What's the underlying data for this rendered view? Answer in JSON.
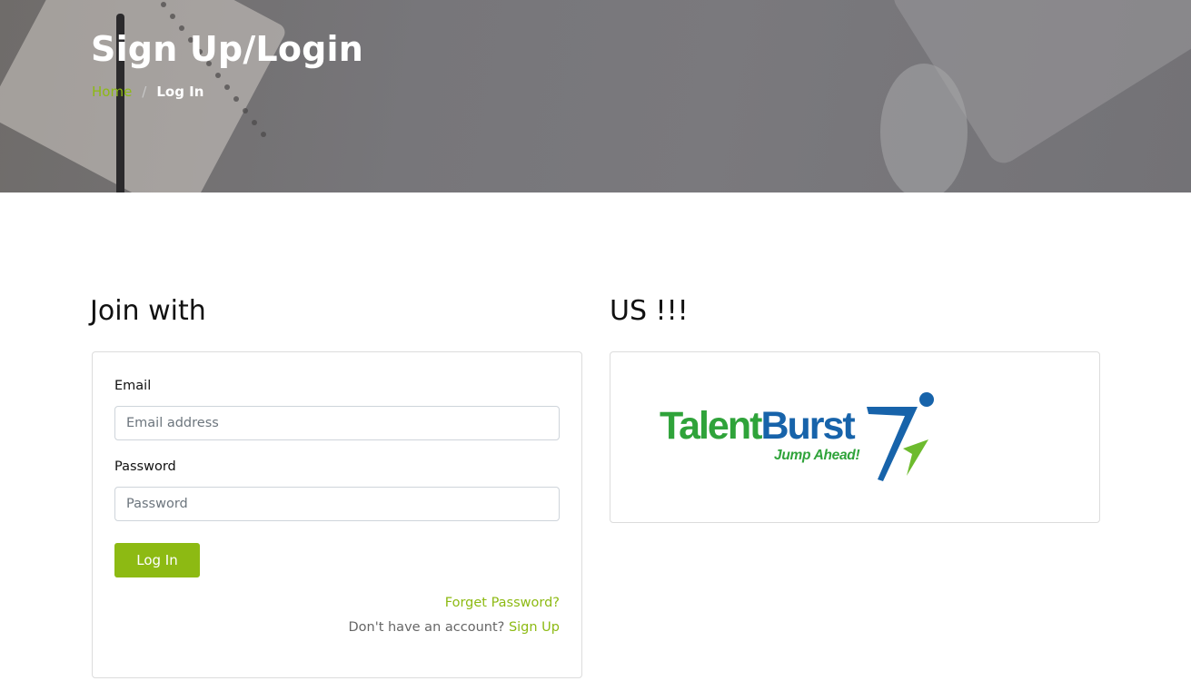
{
  "header": {
    "title": "Sign Up/Login",
    "breadcrumb": {
      "home": "Home",
      "separator": "/",
      "current": "Log In"
    }
  },
  "left_section": {
    "heading": "Join with",
    "form": {
      "email_label": "Email",
      "email_placeholder": "Email address",
      "email_value": "",
      "password_label": "Password",
      "password_placeholder": "Password",
      "password_value": "",
      "login_button": "Log In",
      "forgot_link": "Forget Password?",
      "no_account_text": "Don't have an account?",
      "signup_link": "Sign Up"
    }
  },
  "right_section": {
    "heading": "US !!!",
    "logo": {
      "brand_part1": "Talent",
      "brand_part2": "Burst",
      "tagline": "Jump Ahead!"
    }
  },
  "colors": {
    "accent": "#8dba13",
    "logo_green": "#2fa33a",
    "logo_blue": "#1763aa"
  }
}
